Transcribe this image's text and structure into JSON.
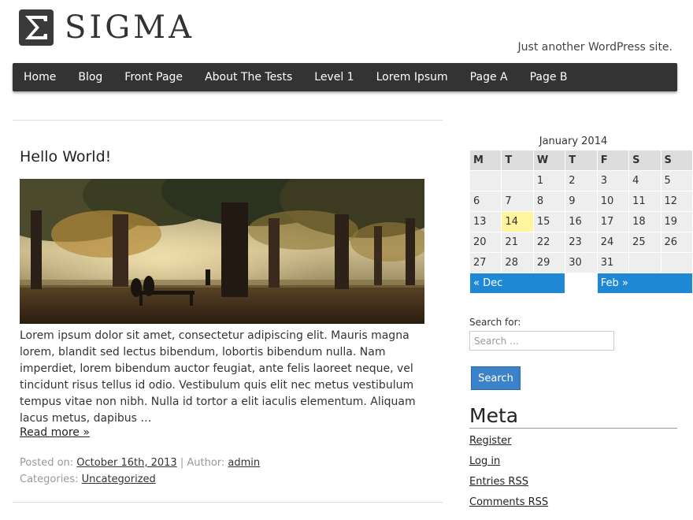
{
  "site": {
    "title": "SIGMA",
    "tagline": "Just another WordPress site."
  },
  "nav": {
    "items": [
      "Home",
      "Blog",
      "Front Page",
      "About The Tests",
      "Level 1",
      "Lorem Ipsum",
      "Page A",
      "Page B"
    ]
  },
  "post": {
    "title": "Hello World!",
    "excerpt": "Lorem ipsum dolor sit amet, consectetur adipiscing elit. Mauris magna lorem, blandit sed lectus bibendum, lobortis bibendum nulla. Nam imperdiet, lorem bibendum auctor feugiat, ante felis laoreet neque, vel tincidunt risus tellus id odio. Vestibulum quis elit nec metus vestibulum tempus vitae non nibh. Nulla id tortor a elit iaculis elementum. Aliquam lacus metus, dapibus …",
    "read_more": "Read more »",
    "posted_on_label": "Posted on:",
    "date": "October 16th, 2013",
    "separator": "|",
    "author_label": "Author:",
    "author": "admin",
    "categories_label": "Categories:",
    "category": "Uncategorized"
  },
  "calendar": {
    "caption": "January 2014",
    "weekdays": [
      "M",
      "T",
      "W",
      "T",
      "F",
      "S",
      "S"
    ],
    "weeks": [
      [
        "",
        "",
        "1",
        "2",
        "3",
        "4",
        "5"
      ],
      [
        "6",
        "7",
        "8",
        "9",
        "10",
        "11",
        "12"
      ],
      [
        "13",
        "14",
        "15",
        "16",
        "17",
        "18",
        "19"
      ],
      [
        "20",
        "21",
        "22",
        "23",
        "24",
        "25",
        "26"
      ],
      [
        "27",
        "28",
        "29",
        "30",
        "31",
        "",
        ""
      ]
    ],
    "today": "14",
    "prev": "« Dec",
    "next": "Feb »"
  },
  "search": {
    "label": "Search for:",
    "placeholder": "Search …",
    "button": "Search"
  },
  "meta": {
    "heading": "Meta",
    "links": [
      "Register",
      "Log in",
      "Entries RSS",
      "Comments RSS"
    ]
  }
}
